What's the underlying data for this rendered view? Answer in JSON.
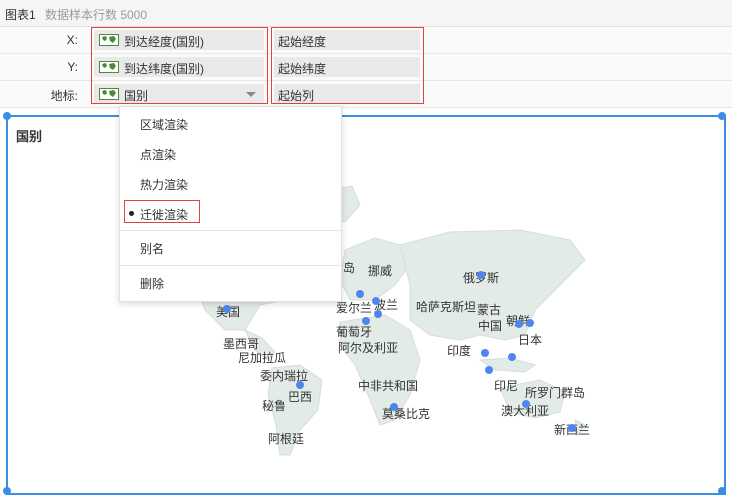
{
  "header": {
    "chart_name": "图表1",
    "sample_info": "数据样本行数 5000"
  },
  "fields": {
    "x": {
      "axis_label": "X:",
      "field_label": "到达经度(国别)",
      "start_label": "起始经度"
    },
    "y": {
      "axis_label": "Y:",
      "field_label": "到达纬度(国别)",
      "start_label": "起始纬度"
    },
    "geo": {
      "axis_label": "地标:",
      "field_label": "国别",
      "start_label": "起始列"
    }
  },
  "icons": {
    "field_icon": "world-map-icon",
    "dropdown": "caret-down-icon",
    "selected_marker": "bullet-icon"
  },
  "colors": {
    "accent": "#3a8ee6",
    "highlight": "#e0443c",
    "point": "#4e86f0",
    "land": "#e3ebe6"
  },
  "menu": {
    "items": [
      "区域渲染",
      "点渲染",
      "热力渲染",
      "迁徙渲染"
    ],
    "selected": "迁徙渲染",
    "alias": "别名",
    "delete": "删除"
  },
  "chart": {
    "title": "国别",
    "countries": [
      "岛",
      "挪威",
      "俄罗斯",
      "爱尔兰",
      "波兰",
      "哈萨克斯坦",
      "蒙古",
      "美国",
      "葡萄牙",
      "中国",
      "朝鲜",
      "日本",
      "墨西哥",
      "阿尔及利亚",
      "印度",
      "尼加拉瓜",
      "委内瑞拉",
      "中非共和国",
      "印尼",
      "所罗门群岛",
      "巴西",
      "秘鲁",
      "莫桑比克",
      "澳大利亚",
      "新西兰",
      "阿根廷"
    ]
  }
}
